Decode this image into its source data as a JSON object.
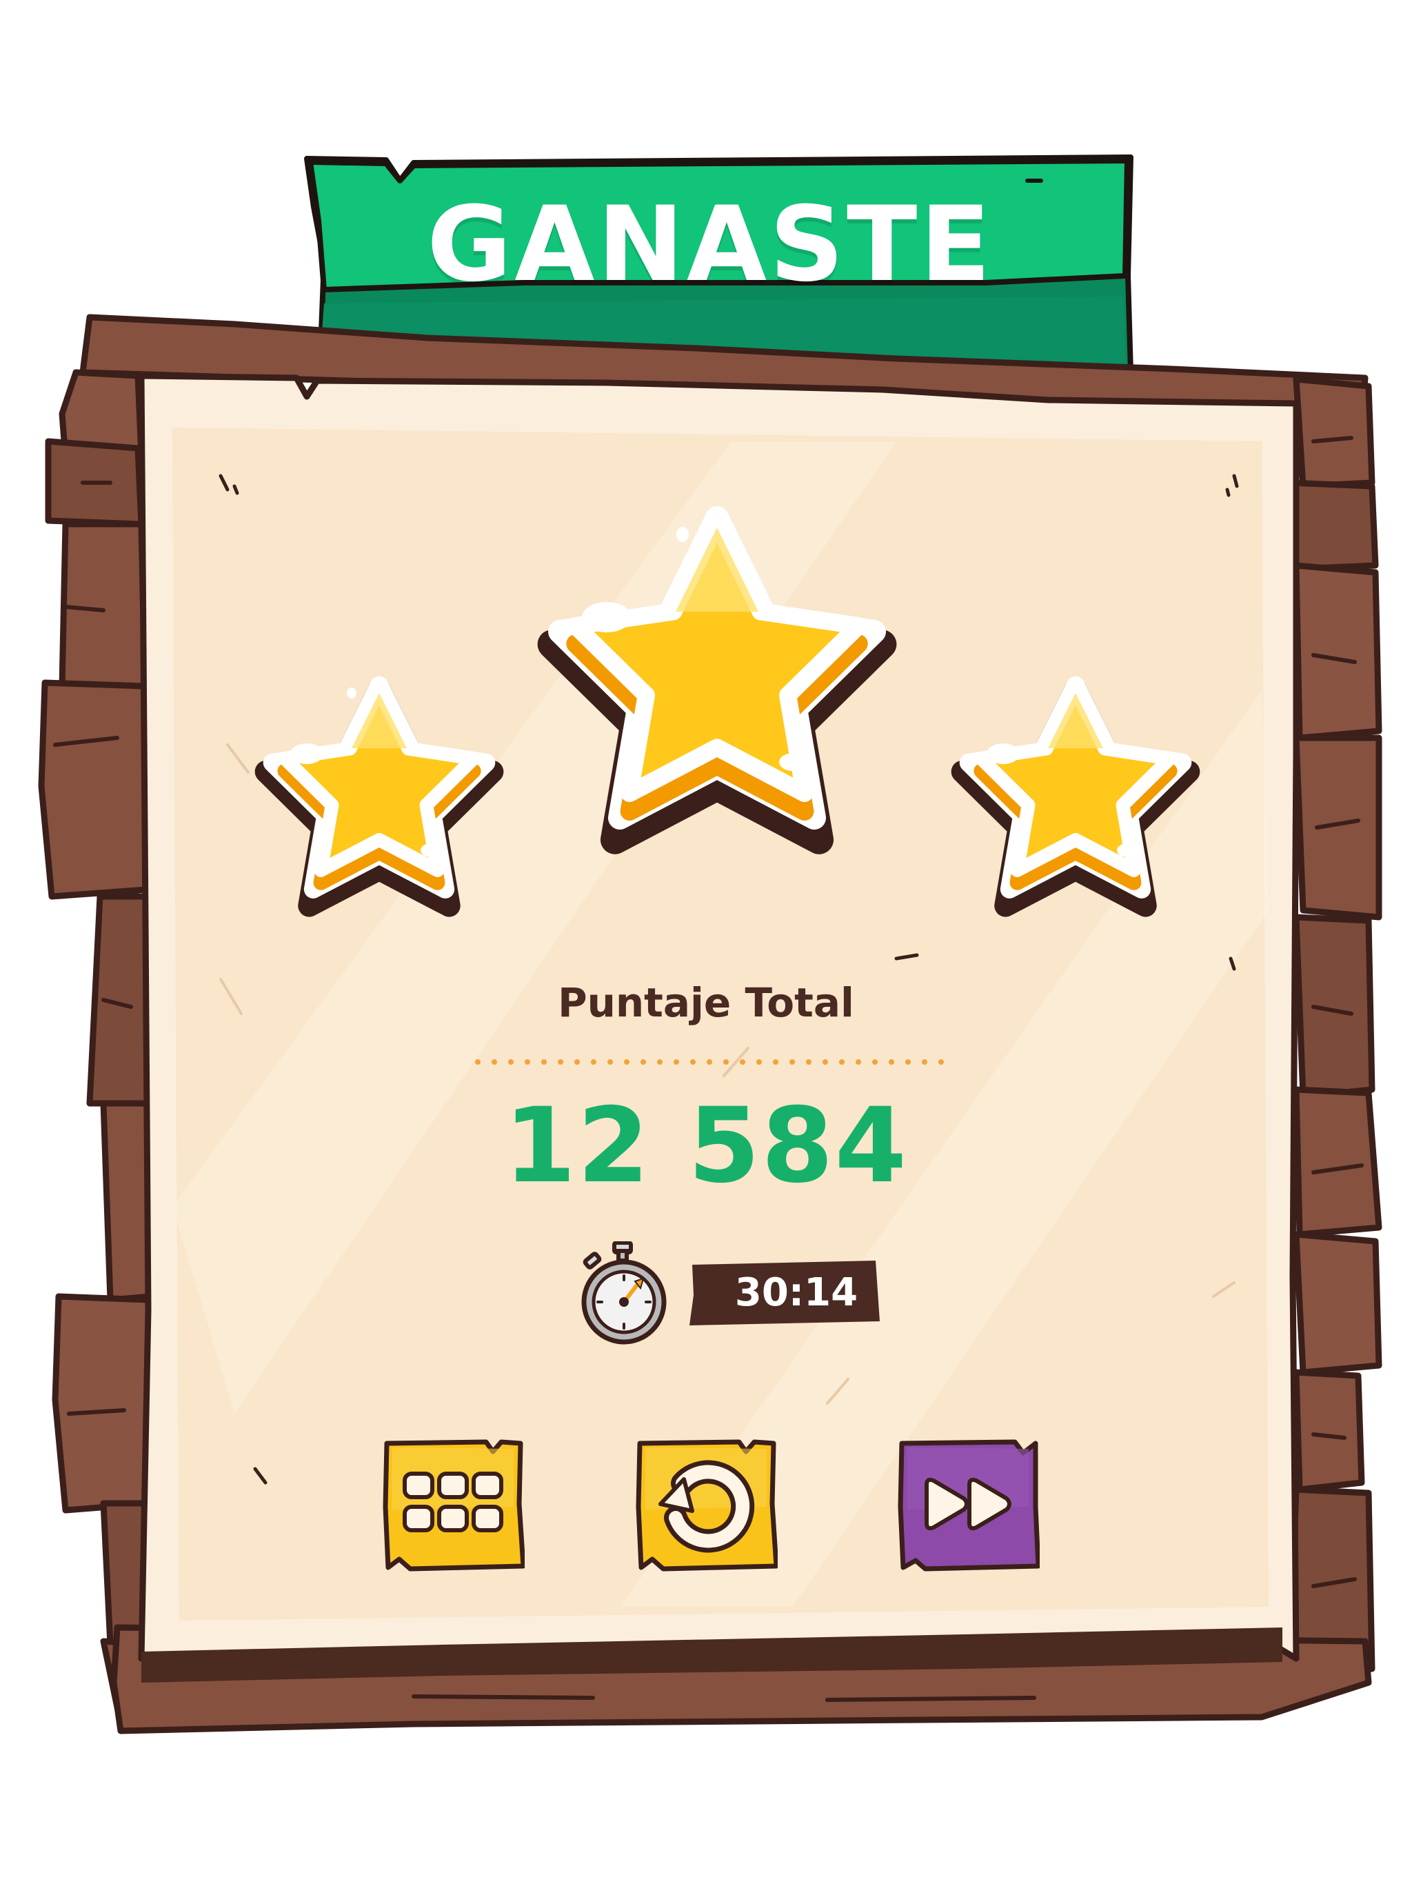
{
  "header": {
    "title": "GANASTE"
  },
  "rating": {
    "stars_earned": 3,
    "stars_total": 3
  },
  "score": {
    "label": "Puntaje Total",
    "value": "12 584"
  },
  "timer": {
    "icon": "stopwatch-icon",
    "value": "30:14"
  },
  "buttons": [
    {
      "name": "level-select-button",
      "icon": "grid-icon"
    },
    {
      "name": "replay-button",
      "icon": "restart-icon"
    },
    {
      "name": "next-level-button",
      "icon": "fast-forward-icon"
    }
  ],
  "colors": {
    "banner_green": "#12c37a",
    "score_green": "#17b06b",
    "wood": "#86513f",
    "outline": "#3b1f1a",
    "paper": "#fbeedd",
    "star_gold": "#ffca12",
    "button_yellow": "#f9c31a",
    "button_purple": "#8d4aa8"
  }
}
